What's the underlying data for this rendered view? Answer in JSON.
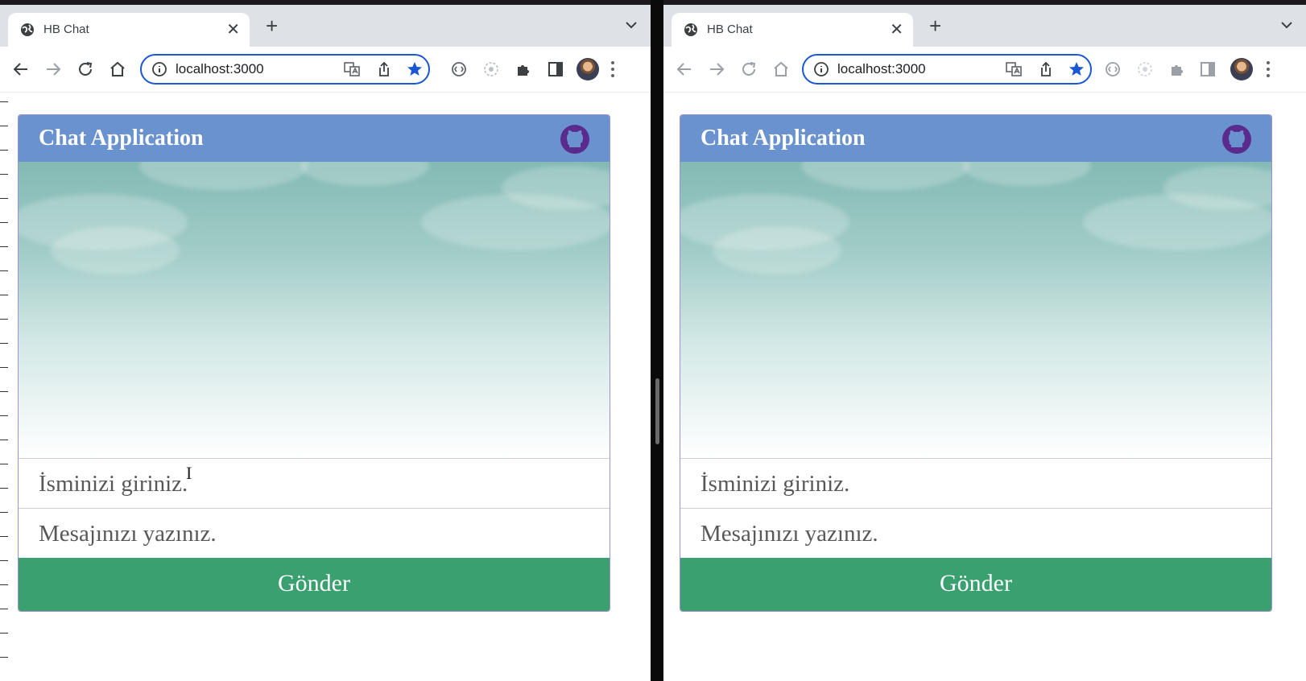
{
  "browsers": [
    {
      "tab": {
        "title": "HB Chat"
      },
      "address_bar": {
        "url": "localhost:3000"
      },
      "app": {
        "title": "Chat Application",
        "name_input": {
          "placeholder": "İsminizi giriniz."
        },
        "message_input": {
          "placeholder": "Mesajınızı yazınız."
        },
        "send_label": "Gönder"
      }
    },
    {
      "tab": {
        "title": "HB Chat"
      },
      "address_bar": {
        "url": "localhost:3000"
      },
      "app": {
        "title": "Chat Application",
        "name_input": {
          "placeholder": "İsminizi giriniz."
        },
        "message_input": {
          "placeholder": "Mesajınızı yazınız."
        },
        "send_label": "Gönder"
      }
    }
  ],
  "icons": {
    "tab": [
      "globe-icon",
      "close-icon",
      "new-tab-icon",
      "tab-search-icon"
    ],
    "toolbar": [
      "back-icon",
      "forward-icon",
      "reload-icon",
      "home-icon",
      "site-info-icon",
      "translate-icon",
      "share-icon",
      "bookmark-star-icon",
      "extension-icon",
      "extension-icon",
      "puzzle-extensions-icon",
      "side-panel-icon",
      "profile-avatar",
      "more-icon"
    ],
    "app": [
      "github-icon"
    ]
  },
  "colors": {
    "header": "#6a92cf",
    "send_button": "#3aa070",
    "omnibox_focus": "#1a57d2",
    "bookmark_star": "#1a57d2"
  }
}
